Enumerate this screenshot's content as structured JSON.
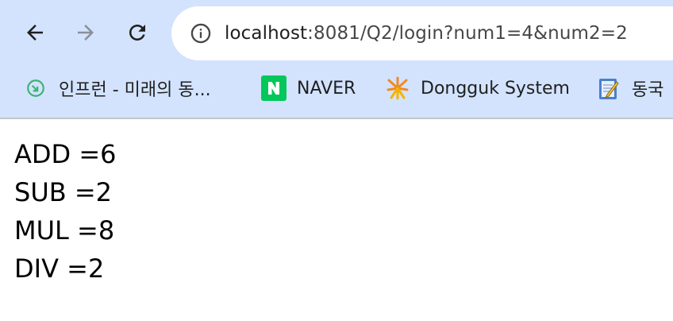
{
  "nav": {
    "back_icon": "arrow-left",
    "forward_icon": "arrow-right",
    "reload_icon": "reload"
  },
  "omnibox": {
    "host": "localhost",
    "rest": ":8081/Q2/login?num1=4&num2=2"
  },
  "bookmarks": [
    {
      "label": "인프런 - 미래의 동...",
      "icon": "inflearn-icon"
    },
    {
      "label": "NAVER",
      "icon": "naver-icon"
    },
    {
      "label": "Dongguk System",
      "icon": "dongguk-icon"
    },
    {
      "label": "동국",
      "icon": "notepad-icon"
    }
  ],
  "results": {
    "add": "ADD =6",
    "sub": "SUB =2",
    "mul": "MUL =8",
    "div": "DIV =2"
  },
  "colors": {
    "chrome_bg": "#d3e3fd",
    "naver_green": "#03c75a"
  }
}
